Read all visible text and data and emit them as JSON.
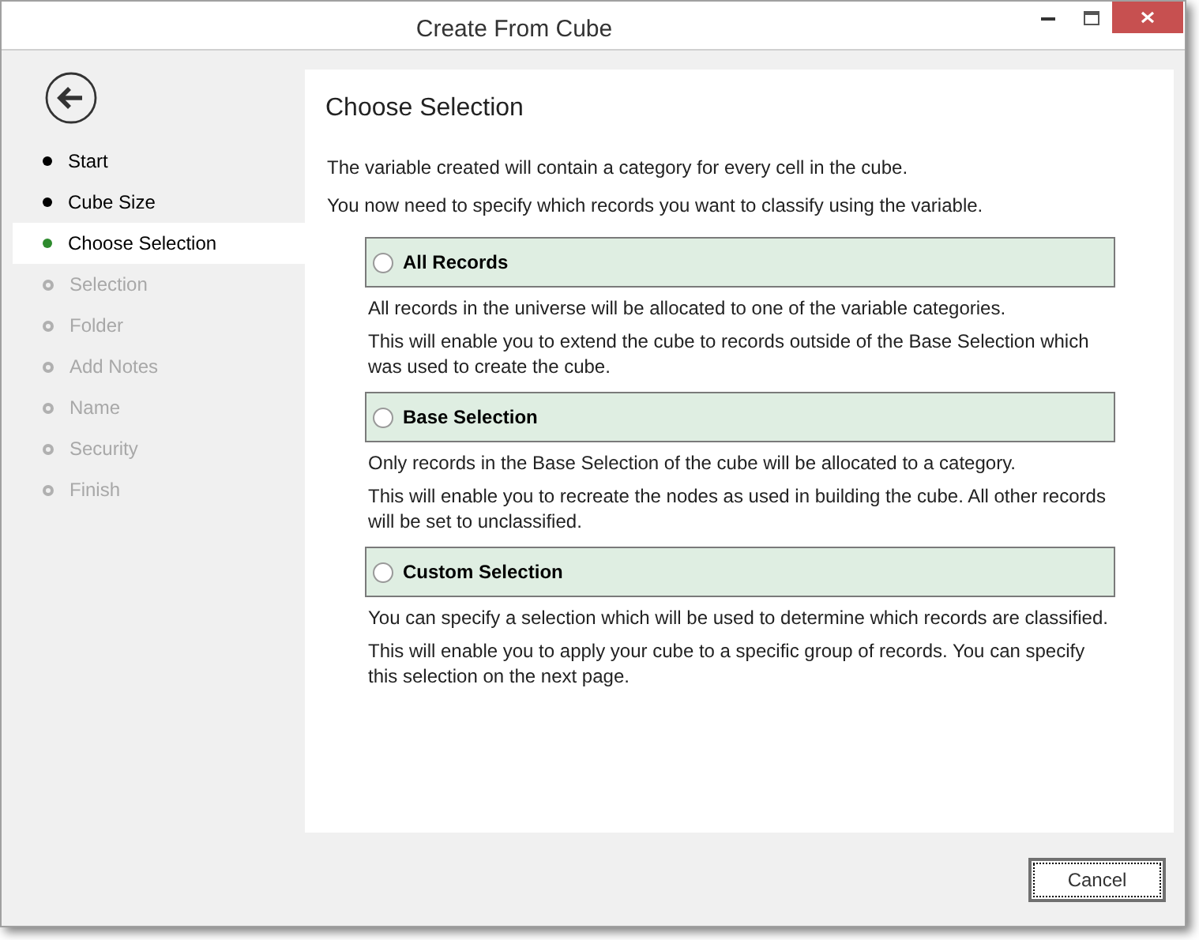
{
  "window": {
    "title": "Create From Cube"
  },
  "steps": [
    {
      "label": "Start",
      "selected": false,
      "disabled": false
    },
    {
      "label": "Cube Size",
      "selected": false,
      "disabled": false
    },
    {
      "label": "Choose Selection",
      "selected": true,
      "disabled": false
    },
    {
      "label": "Selection",
      "selected": false,
      "disabled": true
    },
    {
      "label": "Folder",
      "selected": false,
      "disabled": true
    },
    {
      "label": "Add Notes",
      "selected": false,
      "disabled": true
    },
    {
      "label": "Name",
      "selected": false,
      "disabled": true
    },
    {
      "label": "Security",
      "selected": false,
      "disabled": true
    },
    {
      "label": "Finish",
      "selected": false,
      "disabled": true
    }
  ],
  "page": {
    "heading": "Choose Selection",
    "intro": [
      "The variable created will contain a category for every cell in the cube.",
      "You now need to specify which records you want to classify using the variable."
    ]
  },
  "options": [
    {
      "label": "All Records",
      "selected": false,
      "description": [
        "All records in the universe will be allocated to one of the variable categories.",
        "This will enable you to extend the cube to records outside of the Base Selection which was used to create the cube."
      ]
    },
    {
      "label": "Base Selection",
      "selected": false,
      "description": [
        "Only records in the Base Selection of the cube will be allocated to a category.",
        "This will enable you to recreate the nodes as used in building the cube. All other records will be set to unclassified."
      ]
    },
    {
      "label": "Custom Selection",
      "selected": false,
      "description": [
        "You can specify a selection which will be used to determine which records are classified.",
        "This will enable you to apply your cube to a specific group of records.  You can specify this selection on the next page."
      ]
    }
  ],
  "buttons": [
    "Cancel"
  ]
}
